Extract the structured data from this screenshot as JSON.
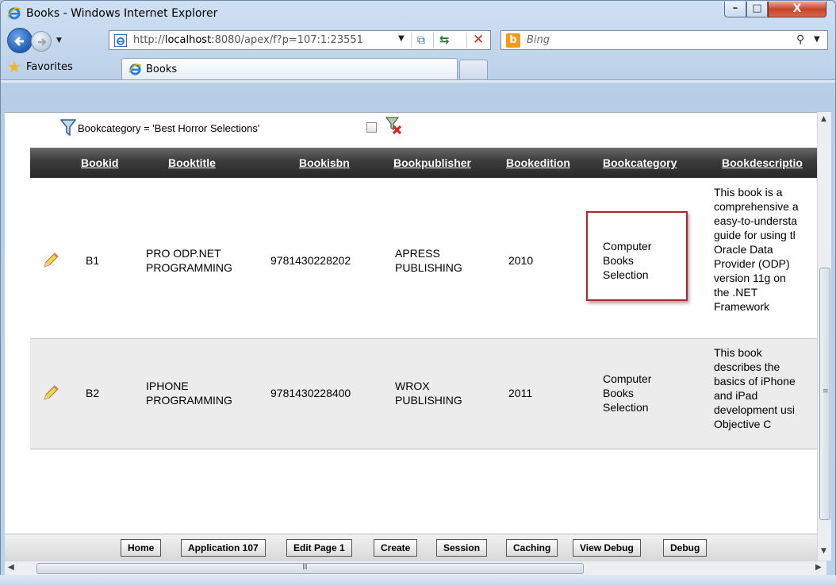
{
  "window": {
    "title": "Books - Windows Internet Explorer",
    "min_glyph": "–",
    "max_glyph": "□",
    "close_glyph": "X"
  },
  "nav": {
    "url_prefix": "http://",
    "url_host": "localhost",
    "url_rest": ":8080/apex/f?p=107:1:23551",
    "search_placeholder": "Bing",
    "bing_logo": "b"
  },
  "favorites": {
    "label": "Favorites",
    "tab_label": "Books"
  },
  "filter": {
    "text": "Bookcategory = 'Best Horror Selections'"
  },
  "report": {
    "headers": [
      "Bookid",
      "Booktitle",
      "Bookisbn",
      "Bookpublisher",
      "Bookedition",
      "Bookcategory",
      "Bookdescriptio"
    ],
    "rows": [
      {
        "id": "B1",
        "title": [
          "PRO ODP.NET",
          "PROGRAMMING"
        ],
        "isbn": "9781430228202",
        "publisher": [
          "APRESS",
          "PUBLISHING"
        ],
        "edition": "2010",
        "category": [
          "Computer",
          "Books",
          "Selection"
        ],
        "description": [
          "This book is a",
          "comprehensive a",
          "easy-to-understa",
          "guide for using tl",
          "Oracle Data",
          "Provider (ODP)",
          "version 11g on",
          "the .NET",
          "Framework"
        ]
      },
      {
        "id": "B2",
        "title": [
          "IPHONE",
          "PROGRAMMING"
        ],
        "isbn": "9781430228400",
        "publisher": [
          "WROX",
          "PUBLISHING"
        ],
        "edition": "2011",
        "category": [
          "Computer",
          "Books",
          "Selection"
        ],
        "description": [
          "This book",
          "describes the",
          "basics of iPhone",
          "and iPad",
          "development usi",
          "Objective C"
        ]
      }
    ]
  },
  "devbar": [
    "Home",
    "Application 107",
    "Edit Page 1",
    "Create",
    "Session",
    "Caching",
    "View Debug",
    "Debug"
  ],
  "scroll": {
    "h_grip": "III",
    "v_grip": "≡"
  }
}
